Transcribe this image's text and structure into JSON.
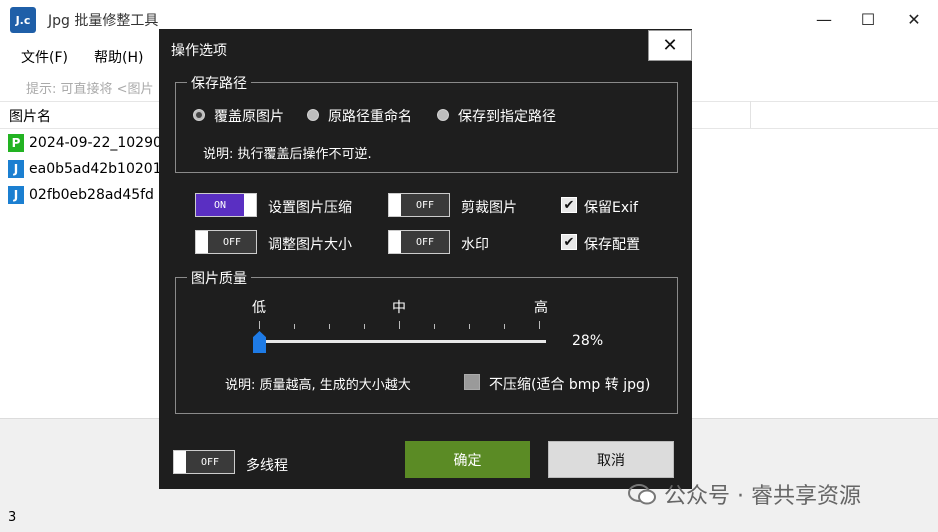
{
  "window": {
    "app_icon_text": "J.c",
    "title": "Jpg 批量修整工具",
    "minimize": "—",
    "maximize": "☐",
    "close": "✕"
  },
  "menu": {
    "file": "文件(F)",
    "help": "帮助(H)"
  },
  "hint": "提示: 可直接将 <图片",
  "list": {
    "column_name": "图片名",
    "files": [
      {
        "name": "2024-09-22_10290",
        "icon_letter": "P",
        "icon_color": "#22b322"
      },
      {
        "name": "ea0b5ad42b10201",
        "icon_letter": "J",
        "icon_color": "#1b7fd1"
      },
      {
        "name": "02fb0eb28ad45fd",
        "icon_letter": "J",
        "icon_color": "#1b7fd1"
      }
    ]
  },
  "status": {
    "count": "3"
  },
  "dialog": {
    "title": "操作选项",
    "close": "✕",
    "save_path": {
      "label": "保存路径",
      "options": [
        "覆盖原图片",
        "原路径重命名",
        "保存到指定路径"
      ],
      "selected": "覆盖原图片",
      "note": "说明: 执行覆盖后操作不可逆."
    },
    "toggles": {
      "compress": {
        "label": "设置图片压缩",
        "state": "ON"
      },
      "crop": {
        "label": "剪裁图片",
        "state": "OFF"
      },
      "resize": {
        "label": "调整图片大小",
        "state": "OFF"
      },
      "watermark": {
        "label": "水印",
        "state": "OFF"
      },
      "multithread": {
        "label": "多线程",
        "state": "OFF"
      }
    },
    "checkboxes": {
      "keep_exif": {
        "label": "保留Exif",
        "checked": true
      },
      "save_config": {
        "label": "保存配置",
        "checked": true
      }
    },
    "quality": {
      "label": "图片质量",
      "low": "低",
      "mid": "中",
      "high": "高",
      "value": 0.28,
      "value_text": "28%",
      "note": "说明: 质量越高, 生成的大小越大",
      "no_compress_label": "不压缩(适合 bmp 转 jpg)",
      "no_compress_checked": false
    },
    "buttons": {
      "ok": "确定",
      "cancel": "取消"
    }
  },
  "watermark_text": "公众号 · 睿共享资源",
  "colors": {
    "toggle_on": "#5a2fc2",
    "ok_button": "#5b8b25",
    "dialog_bg": "#1e1e1e",
    "slider_thumb": "#1e7be6"
  }
}
